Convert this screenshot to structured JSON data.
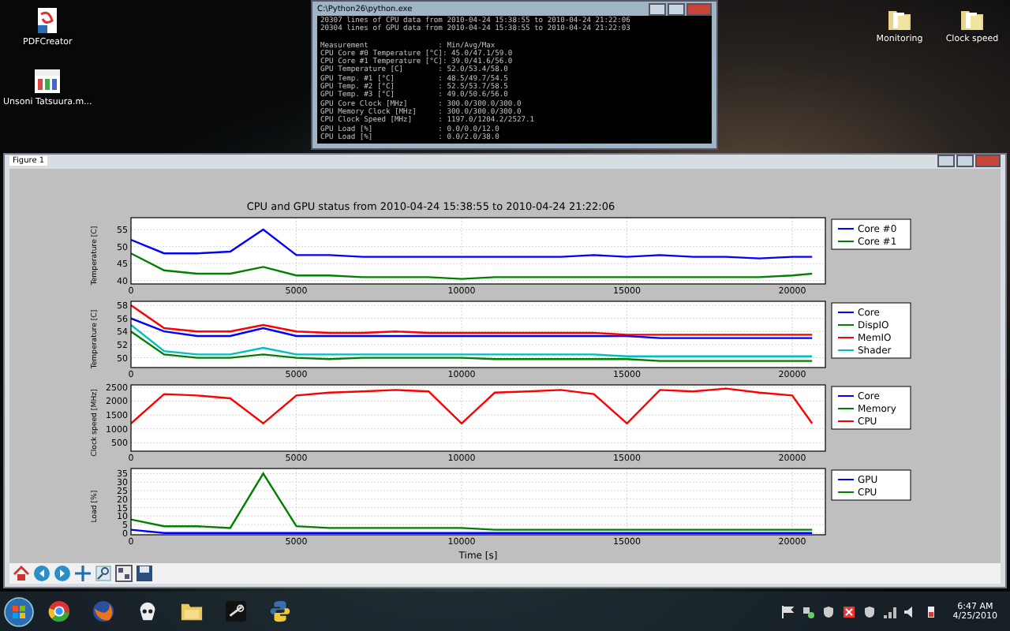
{
  "desktop": {
    "left_icons": [
      {
        "label": "PDFCreator",
        "kind": "document"
      },
      {
        "label": "Unsoni Tatsuura.m...",
        "kind": "video"
      }
    ],
    "right_icons": [
      {
        "label": "Monitoring",
        "kind": "folder"
      },
      {
        "label": "Clock speed",
        "kind": "folder"
      }
    ]
  },
  "console": {
    "title": "C:\\Python26\\python.exe",
    "lines": [
      "20307 lines of CPU data from 2010-04-24 15:38:55 to 2010-04-24 21:22:06",
      "20304 lines of GPU data from 2010-04-24 15:38:55 to 2010-04-24 21:22:03",
      "Measurement                : Min/Avg/Max",
      "CPU Core #0 Temperature [°C]: 45.0/47.1/59.0",
      "CPU Core #1 Temperature [°C]: 39.0/41.6/56.0",
      "GPU Temperature [C]        : 52.0/53.4/58.0",
      "GPU Temp. #1 [°C]          : 48.5/49.7/54.5",
      "GPU Temp. #2 [°C]          : 52.5/53.7/58.5",
      "GPU Temp. #3 [°C]          : 49.0/50.6/56.0",
      "GPU Core Clock [MHz]       : 300.0/300.0/300.0",
      "GPU Memory Clock [MHz]     : 300.0/300.0/300.0",
      "CPU Clock Speed [MHz]      : 1197.0/1204.2/2527.1",
      "GPU Load [%]               : 0.0/0.0/12.0",
      "CPU Load [%]               : 0.0/2.0/38.0"
    ]
  },
  "figure": {
    "title": "Figure 1",
    "heading": "CPU and GPU status from 2010-04-24 15:38:55 to 2010-04-24 21:22:06",
    "subplots": [
      {
        "chart_data": {
          "type": "line",
          "ylabel": "Temperature [C]",
          "x": [
            0,
            1000,
            2000,
            3000,
            4000,
            5000,
            6000,
            7000,
            8000,
            9000,
            10000,
            11000,
            12000,
            13000,
            14000,
            15000,
            16000,
            17000,
            18000,
            19000,
            20000,
            20600
          ],
          "xlim": [
            0,
            21000
          ],
          "ylim": [
            39,
            58.5
          ],
          "xticks": [
            0,
            5000,
            10000,
            15000,
            20000
          ],
          "yticks": [
            40,
            45,
            50,
            55
          ],
          "grid": true,
          "legend": "upper right",
          "series": [
            {
              "name": "Core #0",
              "color": "#0000ff",
              "values": [
                52,
                48,
                48,
                48.5,
                55,
                47.5,
                47.5,
                47,
                47,
                47,
                47,
                47,
                47,
                47,
                47.5,
                47,
                47.5,
                47,
                47,
                46.5,
                47,
                47
              ]
            },
            {
              "name": "Core #1",
              "color": "#008000",
              "values": [
                48,
                43,
                42,
                42,
                44,
                41.5,
                41.5,
                41,
                41,
                41,
                40.5,
                41,
                41,
                41,
                41,
                41,
                41,
                41,
                41,
                41,
                41.5,
                42
              ]
            }
          ]
        }
      },
      {
        "chart_data": {
          "type": "line",
          "ylabel": "Temperature [C]",
          "x": [
            0,
            1000,
            2000,
            3000,
            4000,
            5000,
            6000,
            7000,
            8000,
            9000,
            10000,
            11000,
            12000,
            13000,
            14000,
            15000,
            16000,
            17000,
            18000,
            19000,
            20000,
            20600
          ],
          "xlim": [
            0,
            21000
          ],
          "ylim": [
            48.5,
            58.6
          ],
          "xticks": [
            0,
            5000,
            10000,
            15000,
            20000
          ],
          "yticks": [
            50,
            52,
            54,
            56,
            58
          ],
          "grid": true,
          "legend": "upper right",
          "series": [
            {
              "name": "Core",
              "color": "#0000ff",
              "values": [
                56,
                54,
                53.3,
                53.3,
                54.5,
                53.3,
                53.3,
                53.3,
                53.3,
                53.3,
                53.3,
                53.3,
                53.3,
                53.3,
                53.3,
                53.3,
                53,
                53,
                53,
                53,
                53,
                53
              ]
            },
            {
              "name": "DispIO",
              "color": "#008000",
              "values": [
                54,
                50.5,
                50,
                50,
                50.5,
                50,
                49.8,
                50,
                50,
                50,
                50,
                49.8,
                49.8,
                49.8,
                49.8,
                49.8,
                49.5,
                49.5,
                49.5,
                49.5,
                49.5,
                49.5
              ]
            },
            {
              "name": "MemIO",
              "color": "#ff0000",
              "values": [
                58,
                54.5,
                54,
                54,
                55,
                54,
                53.8,
                53.8,
                54,
                53.8,
                53.8,
                53.8,
                53.8,
                53.8,
                53.8,
                53.5,
                53.5,
                53.5,
                53.5,
                53.5,
                53.5,
                53.5
              ]
            },
            {
              "name": "Shader",
              "color": "#00bfbf",
              "values": [
                55,
                51,
                50.5,
                50.5,
                51.5,
                50.5,
                50.5,
                50.5,
                50.5,
                50.5,
                50.5,
                50.5,
                50.5,
                50.5,
                50.5,
                50.2,
                50.2,
                50.2,
                50.2,
                50.2,
                50.2,
                50.2
              ]
            }
          ]
        }
      },
      {
        "chart_data": {
          "type": "line",
          "ylabel": "Clock speed [MHz]",
          "x": [
            0,
            1000,
            2000,
            3000,
            4000,
            5000,
            6000,
            7000,
            8000,
            9000,
            10000,
            11000,
            12000,
            13000,
            14000,
            15000,
            16000,
            17000,
            18000,
            19000,
            20000,
            20600
          ],
          "xlim": [
            0,
            21000
          ],
          "ylim": [
            200,
            2580
          ],
          "xticks": [
            0,
            5000,
            10000,
            15000,
            20000
          ],
          "yticks": [
            500,
            1000,
            1500,
            2000,
            2500
          ],
          "grid": true,
          "legend": "upper right",
          "series": [
            {
              "name": "Core",
              "color": "#0000ff",
              "values": [
                null,
                null,
                null,
                null,
                null,
                null,
                null,
                null,
                null,
                null,
                null,
                null,
                null,
                null,
                null,
                null,
                null,
                null,
                null,
                null,
                null,
                null
              ]
            },
            {
              "name": "Memory",
              "color": "#008000",
              "values": [
                null,
                null,
                null,
                null,
                null,
                null,
                null,
                null,
                null,
                null,
                null,
                null,
                null,
                null,
                null,
                null,
                null,
                null,
                null,
                null,
                null,
                null
              ]
            },
            {
              "name": "CPU",
              "color": "#ff0000",
              "values": [
                1200,
                2250,
                2200,
                2100,
                1200,
                2200,
                2300,
                2350,
                2400,
                2350,
                1200,
                2300,
                2350,
                2400,
                2250,
                1200,
                2400,
                2350,
                2450,
                2300,
                2200,
                1200
              ]
            }
          ]
        }
      },
      {
        "chart_data": {
          "type": "line",
          "xlabel": "Time [s]",
          "ylabel": "Load [%]",
          "x": [
            0,
            1000,
            2000,
            3000,
            4000,
            5000,
            6000,
            7000,
            8000,
            9000,
            10000,
            11000,
            12000,
            13000,
            14000,
            15000,
            16000,
            17000,
            18000,
            19000,
            20000,
            20600
          ],
          "xlim": [
            0,
            21000
          ],
          "ylim": [
            -1,
            38
          ],
          "xticks": [
            0,
            5000,
            10000,
            15000,
            20000
          ],
          "yticks": [
            0,
            5,
            10,
            15,
            20,
            25,
            30,
            35
          ],
          "grid": true,
          "legend": "upper right",
          "series": [
            {
              "name": "GPU",
              "color": "#0000ff",
              "values": [
                2,
                0,
                0,
                0,
                0,
                0,
                0,
                0,
                0,
                0,
                0,
                0,
                0,
                0,
                0,
                0,
                0,
                0,
                0,
                0,
                0,
                0
              ]
            },
            {
              "name": "CPU",
              "color": "#008000",
              "values": [
                8,
                4,
                4,
                3,
                35,
                4,
                3,
                3,
                3,
                3,
                3,
                2,
                2,
                2,
                2,
                2,
                2,
                2,
                2,
                2,
                2,
                2
              ]
            }
          ]
        }
      }
    ],
    "toolbar": [
      {
        "kind": "home"
      },
      {
        "kind": "back"
      },
      {
        "kind": "forward"
      },
      {
        "kind": "pan"
      },
      {
        "kind": "zoom"
      },
      {
        "kind": "configure"
      },
      {
        "kind": "save"
      }
    ]
  },
  "taskbar": {
    "apps": [
      {
        "kind": "chrome"
      },
      {
        "kind": "firefox"
      },
      {
        "kind": "skull"
      },
      {
        "kind": "folder"
      },
      {
        "kind": "steam"
      },
      {
        "kind": "python"
      }
    ],
    "tray": [
      {
        "kind": "flag"
      },
      {
        "kind": "network"
      },
      {
        "kind": "shield"
      },
      {
        "kind": "warning"
      },
      {
        "kind": "shield"
      },
      {
        "kind": "signal"
      },
      {
        "kind": "speaker"
      },
      {
        "kind": "battery"
      }
    ],
    "time": "6:47 AM",
    "date": "4/25/2010"
  }
}
